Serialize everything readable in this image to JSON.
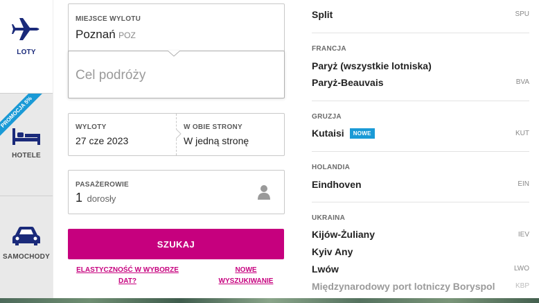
{
  "sidebar": {
    "flights": {
      "label": "LOTY"
    },
    "hotels": {
      "label": "HOTELE",
      "promo": "PROMOCJA 5%"
    },
    "cars": {
      "label": "SAMOCHODY"
    }
  },
  "form": {
    "origin": {
      "label": "MIEJSCE WYLOTU",
      "value": "Poznań",
      "code": "POZ"
    },
    "destination": {
      "placeholder": "Cel podróży"
    },
    "departure": {
      "label": "WYLOTY",
      "value": "27 cze 2023"
    },
    "return": {
      "label": "W OBIE STRONY",
      "value": "W jedną stronę"
    },
    "passengers": {
      "label": "PASAŻEROWIE",
      "count": "1",
      "type": "dorosły"
    },
    "search_label": "SZUKAJ",
    "flex_link_line1": "ELASTYCZNOŚĆ W WYBORZE",
    "flex_link_line2": "DAT?",
    "new_search_line1": "NOWE",
    "new_search_line2": "WYSZUKIWANIE"
  },
  "destinations": {
    "croatia": {
      "cities": [
        {
          "name": "Split",
          "code": "SPU"
        }
      ]
    },
    "france": {
      "country": "FRANCJA",
      "cities": [
        {
          "name": "Paryż (wszystkie lotniska)",
          "code": ""
        },
        {
          "name": "Paryż-Beauvais",
          "code": "BVA"
        }
      ]
    },
    "georgia": {
      "country": "GRUZJA",
      "cities": [
        {
          "name": "Kutaisi",
          "badge": "NOWE",
          "code": "KUT"
        }
      ]
    },
    "netherlands": {
      "country": "HOLANDIA",
      "cities": [
        {
          "name": "Eindhoven",
          "code": "EIN"
        }
      ]
    },
    "ukraine": {
      "country": "UKRAINA",
      "cities": [
        {
          "name": "Kijów-Żuliany",
          "code": "IEV"
        },
        {
          "name": "Kyiv Any",
          "code": ""
        },
        {
          "name": "Lwów",
          "code": "LWO"
        },
        {
          "name": "Międzynarodowy port lotniczy Boryspol",
          "code": "KBP"
        }
      ]
    }
  },
  "colors": {
    "brand": "#c6007e",
    "nav": "#1a2a7a",
    "badge": "#1a9ad6"
  }
}
